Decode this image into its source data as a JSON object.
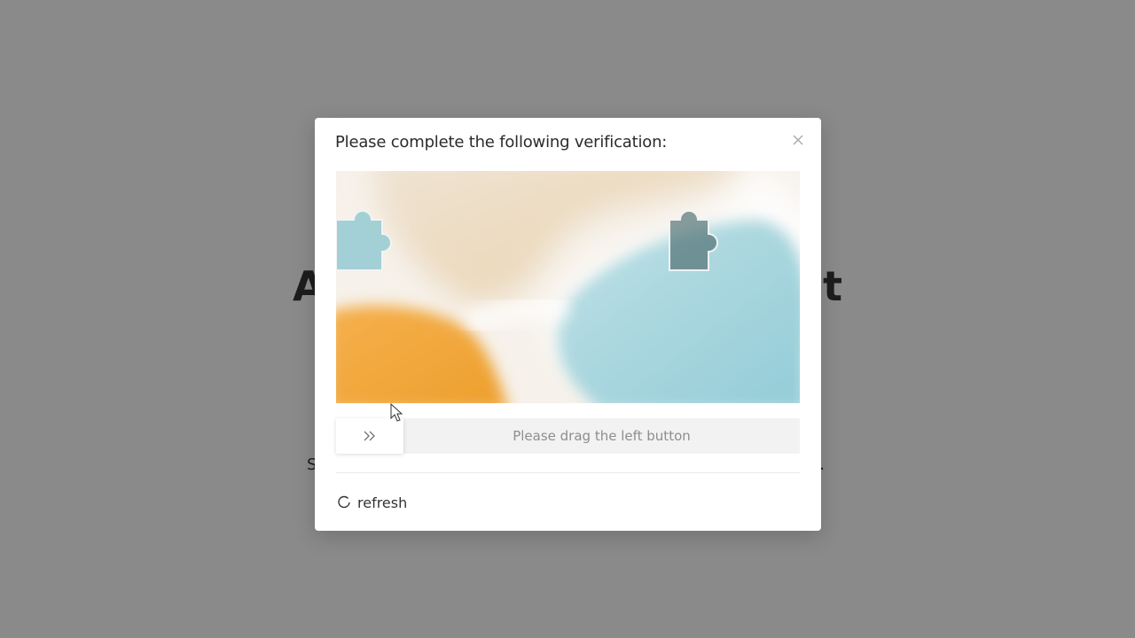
{
  "background": {
    "heading_left": "A",
    "heading_right": "t",
    "sub_left": "S",
    "sub_right": "."
  },
  "modal": {
    "title": "Please complete the following verification:",
    "close_icon": "close-icon",
    "slider_hint": "Please drag the left button",
    "slider_icon": "double-chevron-right-icon",
    "slider_progress": 0,
    "refresh_label": "refresh",
    "refresh_icon": "refresh-icon"
  },
  "colors": {
    "overlay": "#8a8a8a",
    "orange": "#f2a73c",
    "teal": "#9fd0d8",
    "cream": "#f1e3c8"
  }
}
